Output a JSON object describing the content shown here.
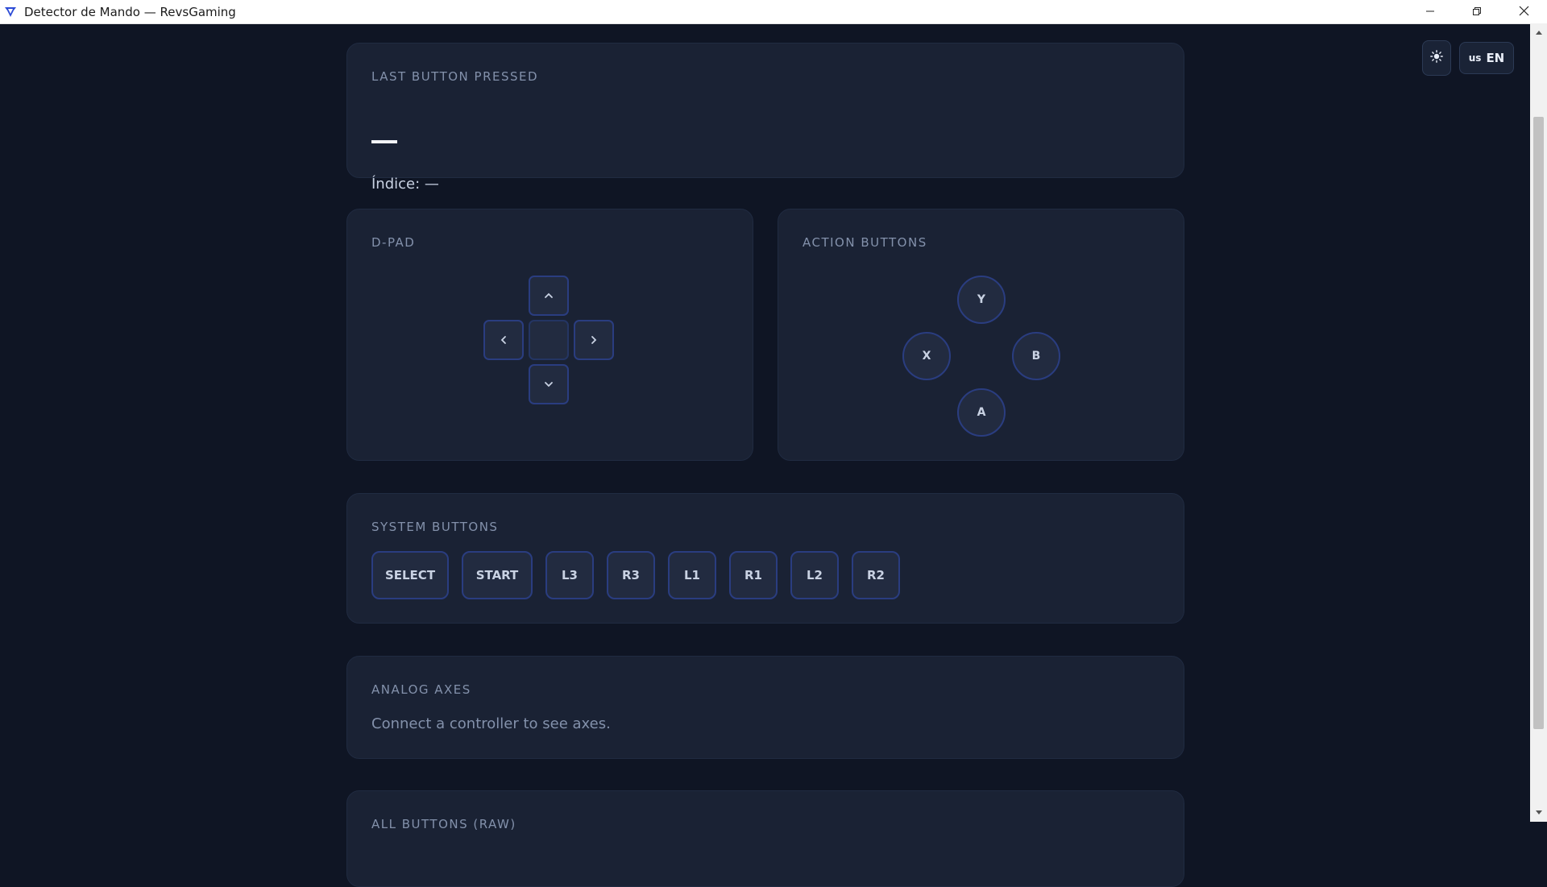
{
  "window": {
    "title": "Detector de Mando — RevsGaming",
    "app_icon": "revsgaming-logo-icon",
    "controls": [
      "minimize-icon",
      "restore-icon",
      "close-icon"
    ]
  },
  "toolbar": {
    "theme_icon": "sun-icon",
    "language": {
      "flag": "us",
      "code": "EN"
    }
  },
  "last_pressed": {
    "label": "LAST BUTTON PRESSED",
    "value": "—",
    "index_text": "Índice: —"
  },
  "dpad": {
    "label": "D-PAD",
    "buttons": [
      "chevron-up-icon",
      "chevron-left-icon",
      "chevron-right-icon",
      "chevron-down-icon"
    ]
  },
  "actions": {
    "label": "ACTION BUTTONS",
    "y": "Y",
    "x": "X",
    "b": "B",
    "a": "A"
  },
  "system": {
    "label": "SYSTEM BUTTONS",
    "buttons": [
      "SELECT",
      "START",
      "L3",
      "R3",
      "L1",
      "R1",
      "L2",
      "R2"
    ]
  },
  "axes": {
    "label": "ANALOG AXES",
    "message": "Connect a controller to see axes."
  },
  "raw": {
    "label": "ALL BUTTONS (RAW)"
  },
  "colors": {
    "background": "#0f1524",
    "card": "#1a2234",
    "button_border": "#2a3d80",
    "muted_text": "#8391ab"
  }
}
